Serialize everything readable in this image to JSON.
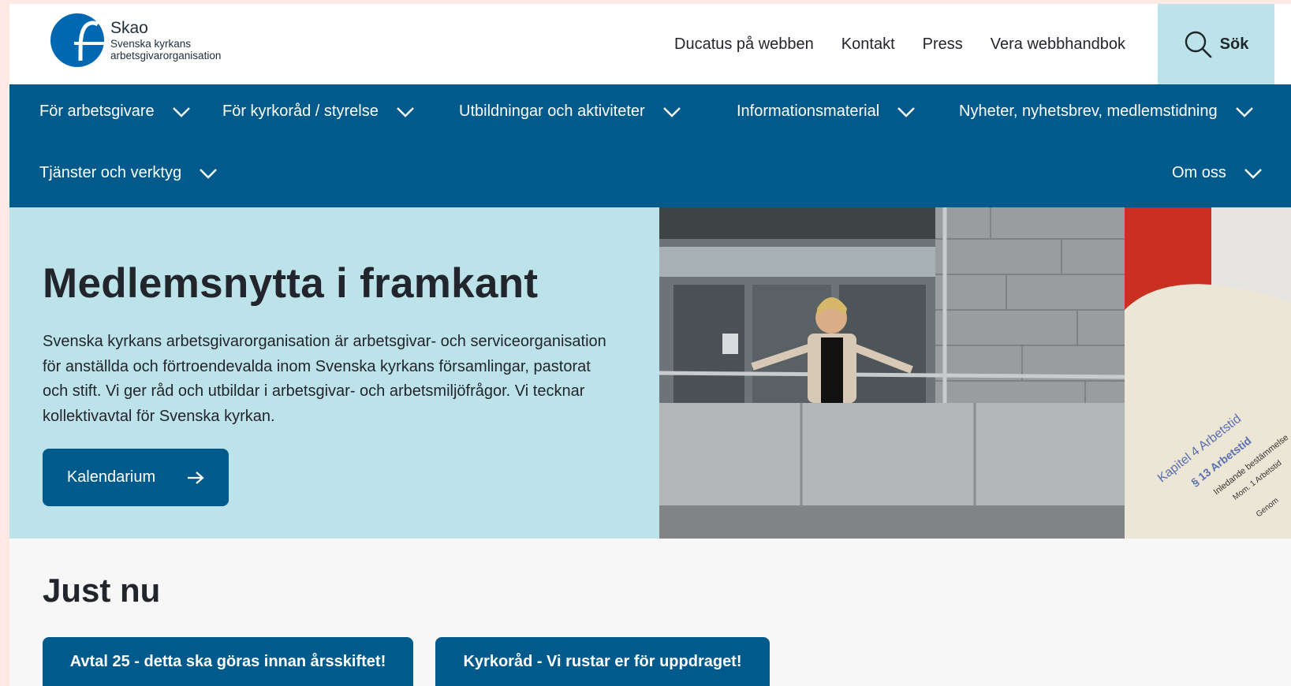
{
  "header": {
    "logo": {
      "name": "Skao",
      "subtitle_line1": "Svenska kyrkans",
      "subtitle_line2": "arbetsgivarorganisation"
    },
    "links": [
      "Ducatus på webben",
      "Kontakt",
      "Press",
      "Vera webbhandbok"
    ],
    "search_label": "Sök"
  },
  "nav": {
    "items": [
      "För arbetsgivare",
      "För kyrkoråd / styrelse",
      "Utbildningar och aktiviteter",
      "Informationsmaterial",
      "Nyheter, nyhetsbrev, medlemstidning",
      "Tjänster och verktyg",
      "Om oss"
    ]
  },
  "hero": {
    "title": "Medlemsnytta i framkant",
    "text": "Svenska kyrkans arbetsgivarorganisation är arbetsgivar- och serviceorganisation för anställda och förtroendevalda inom Svenska kyrkans församlingar, pastorat och stift. Vi ger råd och utbildar i arbetsgivar- och arbetsmiljöfrågor. Vi tecknar kollektivavtal för Svenska kyrkan.",
    "cta_label": "Kalendarium",
    "image_doc_text": {
      "line1": "Kapitel 4 Arbetstid",
      "line2": "§ 13 Arbetstid",
      "line3": "Inledande bestämmelse",
      "line4": "Mom. 1 Arbetstid",
      "line5": "Genom"
    }
  },
  "just_nu": {
    "title": "Just nu",
    "buttons": [
      "Avtal 25 - detta ska göras innan årsskiftet!",
      "Kyrkoråd - Vi rustar er för uppdraget!"
    ]
  },
  "colors": {
    "brand_blue": "#005b8c",
    "light_blue": "#bde3ea",
    "search_bg": "#bce3ea"
  }
}
